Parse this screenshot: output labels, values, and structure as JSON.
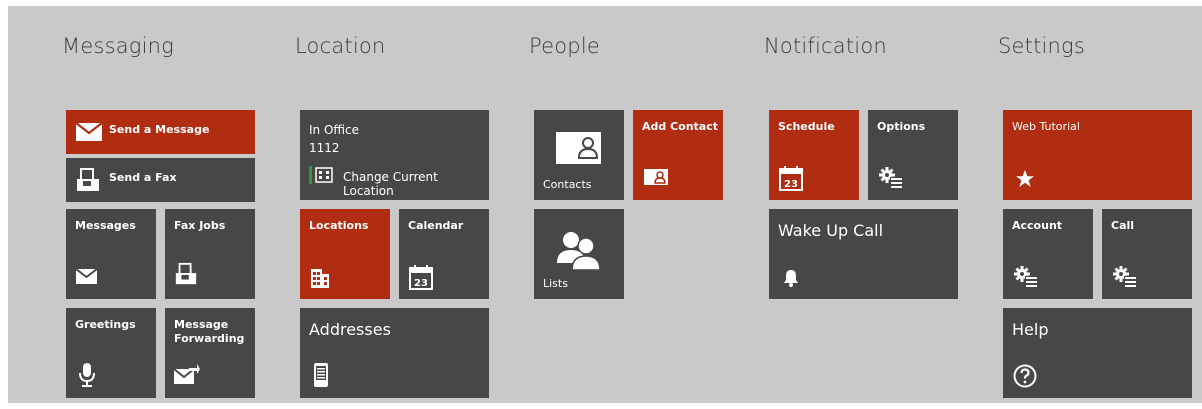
{
  "sections": {
    "messaging": "Messaging",
    "location": "Location",
    "people": "People",
    "notification": "Notification",
    "settings": "Settings"
  },
  "messaging": {
    "send_message": "Send a Message",
    "send_fax": "Send a Fax",
    "messages": "Messages",
    "fax_jobs": "Fax Jobs",
    "greetings": "Greetings",
    "message_forwarding": "Message Forwarding"
  },
  "location": {
    "current_location": "In Office",
    "extension": "1112",
    "change_location": "Change Current Location",
    "locations": "Locations",
    "calendar": "Calendar",
    "addresses": "Addresses"
  },
  "people": {
    "contacts": "Contacts",
    "add_contact": "Add Contact",
    "lists": "Lists"
  },
  "notification": {
    "schedule": "Schedule",
    "options": "Options",
    "wake_up_call": "Wake Up Call",
    "calendar_day": "23"
  },
  "settings": {
    "web_tutorial": "Web Tutorial",
    "account": "Account",
    "call": "Call",
    "help": "Help"
  },
  "colors": {
    "tile_dark": "#474747",
    "tile_accent": "#b12d12",
    "background": "#c9c9c9",
    "status_green": "#2e9a3a"
  },
  "icons": [
    "envelope-icon",
    "fax-icon",
    "microphone-icon",
    "forward-mail-icon",
    "building-icon",
    "calendar-icon",
    "phone-icon",
    "contact-card-icon",
    "people-icon",
    "bell-icon",
    "gear-list-icon",
    "star-icon",
    "help-icon"
  ]
}
